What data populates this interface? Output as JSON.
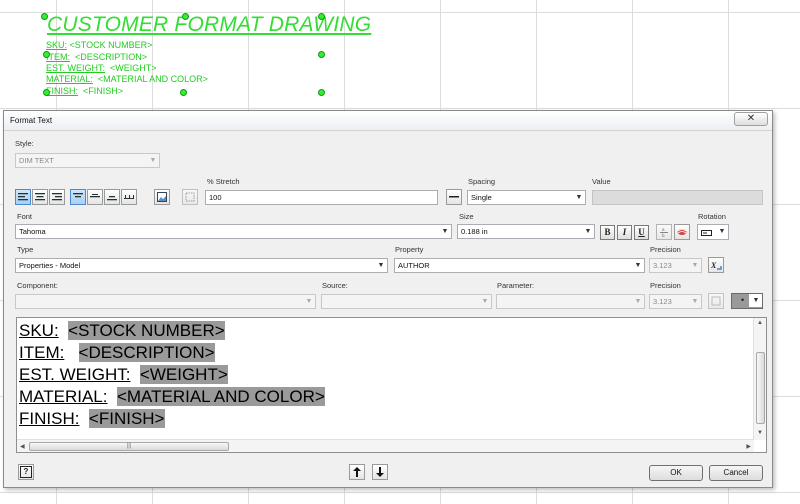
{
  "drawing": {
    "title": "CUSTOMER FORMAT DRAWING",
    "lines": [
      {
        "label": "SKU:",
        "value": "<STOCK NUMBER>"
      },
      {
        "label": "ITEM:",
        "value": "<DESCRIPTION>"
      },
      {
        "label": "EST. WEIGHT:",
        "value": "<WEIGHT>"
      },
      {
        "label": "MATERIAL:",
        "value": "<MATERIAL AND COLOR>"
      },
      {
        "label": "FINISH:",
        "value": "<FINISH>"
      }
    ]
  },
  "dialog": {
    "title": "Format Text",
    "close_glyph": "✕",
    "style": {
      "label": "Style:",
      "value": "DIM TEXT"
    },
    "stretch": {
      "label": "% Stretch",
      "value": "100"
    },
    "spacing": {
      "label": "Spacing",
      "value": "Single"
    },
    "value_field": {
      "label": "Value",
      "value": ""
    },
    "font": {
      "label": "Font",
      "value": "Tahoma"
    },
    "size": {
      "label": "Size",
      "value": "0.188 in"
    },
    "format_buttons": {
      "bold": "B",
      "italic": "I",
      "underline": "U"
    },
    "rotation": {
      "label": "Rotation"
    },
    "type": {
      "label": "Type",
      "value": "Properties - Model"
    },
    "property": {
      "label": "Property",
      "value": "AUTHOR"
    },
    "precision1": {
      "label": "Precision",
      "value": "3.123"
    },
    "component": {
      "label": "Component:",
      "value": ""
    },
    "source": {
      "label": "Source:",
      "value": ""
    },
    "parameter": {
      "label": "Parameter:",
      "value": ""
    },
    "precision2": {
      "label": "Precision",
      "value": "3.123"
    },
    "editor_lines": [
      {
        "key": "SKU:",
        "gap": "  ",
        "value": "<STOCK NUMBER>"
      },
      {
        "key": "ITEM:",
        "gap": "   ",
        "value": "<DESCRIPTION>"
      },
      {
        "key": "EST. WEIGHT:",
        "gap": "  ",
        "value": "<WEIGHT>"
      },
      {
        "key": "MATERIAL:",
        "gap": "  ",
        "value": "<MATERIAL AND COLOR>"
      },
      {
        "key": "FINISH:",
        "gap": "  ",
        "value": "<FINISH>"
      }
    ],
    "help_glyph": "?",
    "ok_label": "OK",
    "cancel_label": "Cancel"
  },
  "colors": {
    "drawing_text": "#22cc22",
    "highlight": "#9a9a9a"
  }
}
